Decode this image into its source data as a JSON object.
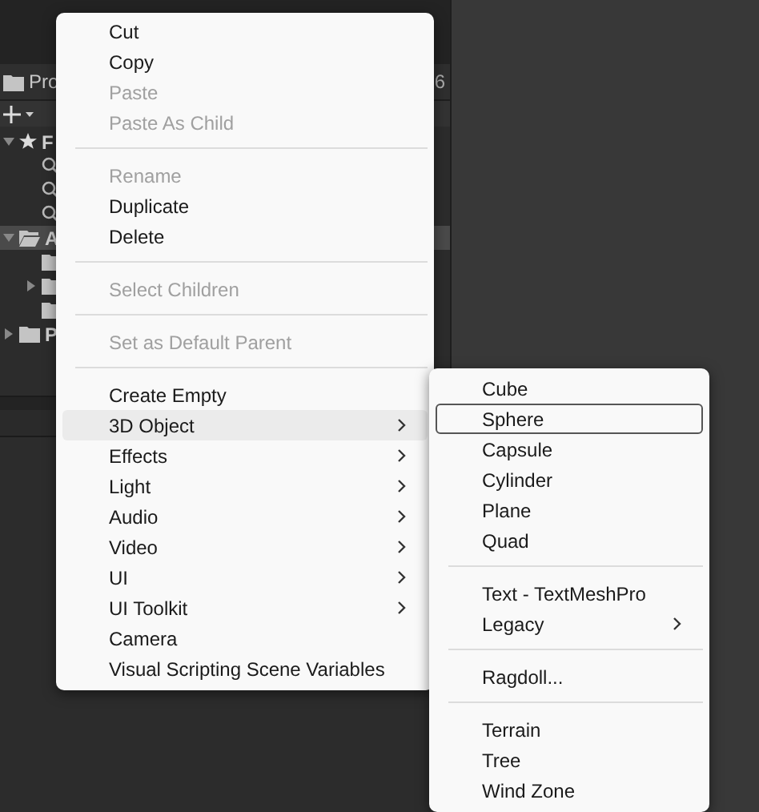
{
  "project_panel": {
    "tab": "Pro",
    "counter": "6",
    "tree": [
      {
        "label": "F",
        "kind": "favorites",
        "expanded": true,
        "selected": false,
        "children": [
          {
            "kind": "search"
          },
          {
            "kind": "search"
          },
          {
            "kind": "search"
          }
        ]
      },
      {
        "label": "A",
        "kind": "folder",
        "expanded": true,
        "selected": true,
        "children": [
          {
            "kind": "folder",
            "expandable": false
          },
          {
            "kind": "folder",
            "expandable": true
          },
          {
            "kind": "folder",
            "expandable": false
          }
        ]
      },
      {
        "label": "P",
        "kind": "folder",
        "expanded": false,
        "selected": false
      }
    ]
  },
  "context_menu": {
    "items": [
      {
        "kind": "item",
        "label": "Cut",
        "disabled": false
      },
      {
        "kind": "item",
        "label": "Copy",
        "disabled": false
      },
      {
        "kind": "item",
        "label": "Paste",
        "disabled": true
      },
      {
        "kind": "item",
        "label": "Paste As Child",
        "disabled": true
      },
      {
        "kind": "separator"
      },
      {
        "kind": "item",
        "label": "Rename",
        "disabled": true
      },
      {
        "kind": "item",
        "label": "Duplicate",
        "disabled": false
      },
      {
        "kind": "item",
        "label": "Delete",
        "disabled": false
      },
      {
        "kind": "separator"
      },
      {
        "kind": "item",
        "label": "Select Children",
        "disabled": true
      },
      {
        "kind": "separator"
      },
      {
        "kind": "item",
        "label": "Set as Default Parent",
        "disabled": true
      },
      {
        "kind": "separator"
      },
      {
        "kind": "item",
        "label": "Create Empty",
        "disabled": false
      },
      {
        "kind": "item",
        "label": "3D Object",
        "disabled": false,
        "submenu": true,
        "selected": true
      },
      {
        "kind": "item",
        "label": "Effects",
        "disabled": false,
        "submenu": true
      },
      {
        "kind": "item",
        "label": "Light",
        "disabled": false,
        "submenu": true
      },
      {
        "kind": "item",
        "label": "Audio",
        "disabled": false,
        "submenu": true
      },
      {
        "kind": "item",
        "label": "Video",
        "disabled": false,
        "submenu": true
      },
      {
        "kind": "item",
        "label": "UI",
        "disabled": false,
        "submenu": true
      },
      {
        "kind": "item",
        "label": "UI Toolkit",
        "disabled": false,
        "submenu": true
      },
      {
        "kind": "item",
        "label": "Camera",
        "disabled": false
      },
      {
        "kind": "item",
        "label": "Visual Scripting Scene Variables",
        "disabled": false
      }
    ]
  },
  "submenu": {
    "items": [
      {
        "kind": "item",
        "label": "Cube",
        "selected": false
      },
      {
        "kind": "item",
        "label": "Sphere",
        "selected": true
      },
      {
        "kind": "item",
        "label": "Capsule",
        "selected": false
      },
      {
        "kind": "item",
        "label": "Cylinder",
        "selected": false
      },
      {
        "kind": "item",
        "label": "Plane",
        "selected": false
      },
      {
        "kind": "item",
        "label": "Quad",
        "selected": false
      },
      {
        "kind": "separator"
      },
      {
        "kind": "item",
        "label": "Text - TextMeshPro",
        "selected": false
      },
      {
        "kind": "item",
        "label": "Legacy",
        "selected": false,
        "submenu": true
      },
      {
        "kind": "separator"
      },
      {
        "kind": "item",
        "label": "Ragdoll...",
        "selected": false
      },
      {
        "kind": "separator"
      },
      {
        "kind": "item",
        "label": "Terrain",
        "selected": false
      },
      {
        "kind": "item",
        "label": "Tree",
        "selected": false
      },
      {
        "kind": "item",
        "label": "Wind Zone",
        "selected": false
      }
    ]
  }
}
